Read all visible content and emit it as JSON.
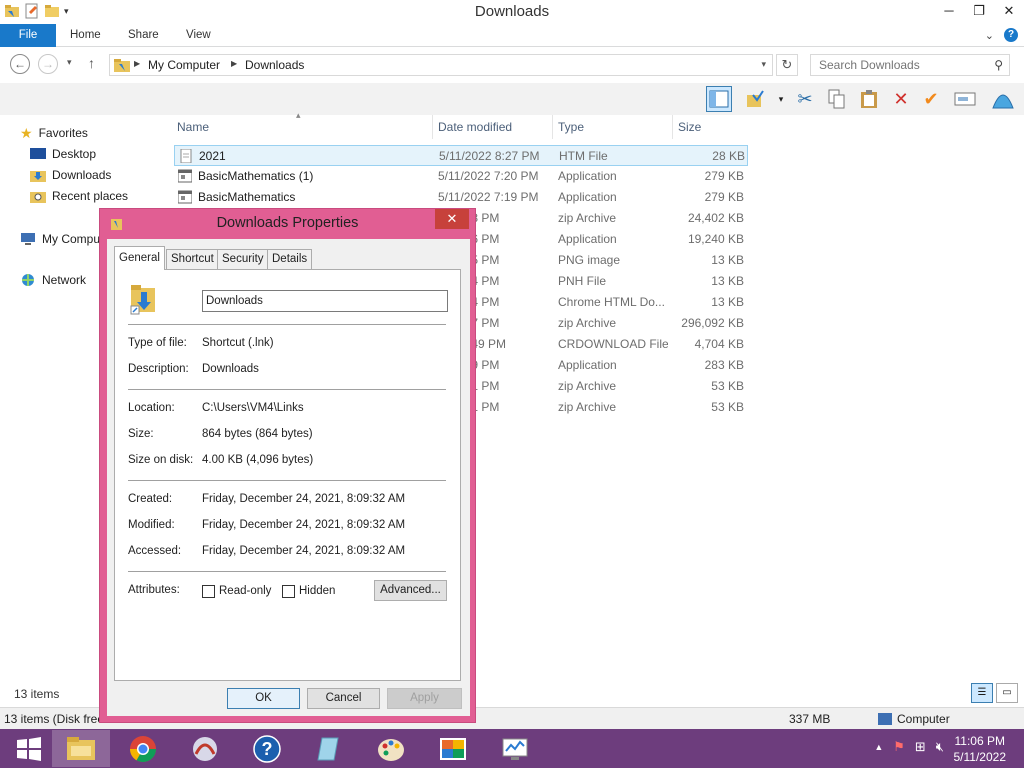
{
  "window": {
    "title": "Downloads"
  },
  "ribbon": {
    "tabs": [
      "File",
      "Home",
      "Share",
      "View"
    ]
  },
  "address": {
    "crumbs": [
      "My Computer",
      "Downloads"
    ],
    "search_placeholder": "Search Downloads"
  },
  "nav": {
    "favorites": "Favorites",
    "desktop": "Desktop",
    "downloads": "Downloads",
    "recent": "Recent places",
    "computer": "My Computer",
    "network": "Network"
  },
  "columns": {
    "name": "Name",
    "date": "Date modified",
    "type": "Type",
    "size": "Size"
  },
  "files": [
    {
      "name": "2021",
      "date": "5/11/2022 8:27 PM",
      "type": "HTM File",
      "size": "28 KB"
    },
    {
      "name": "BasicMathematics (1)",
      "date": "5/11/2022 7:20 PM",
      "type": "Application",
      "size": "279 KB"
    },
    {
      "name": "BasicMathematics",
      "date": "5/11/2022 7:19 PM",
      "type": "Application",
      "size": "279 KB"
    },
    {
      "name": "",
      "date": "22 6:38 PM",
      "type": "zip Archive",
      "size": "24,402 KB"
    },
    {
      "name": "",
      "date": "22 6:36 PM",
      "type": "Application",
      "size": "19,240 KB"
    },
    {
      "name": "",
      "date": "22 6:45 PM",
      "type": "PNG image",
      "size": "13 KB"
    },
    {
      "name": "",
      "date": "22 6:44 PM",
      "type": "PNH File",
      "size": "13 KB"
    },
    {
      "name": "",
      "date": "22 6:44 PM",
      "type": "Chrome HTML Do...",
      "size": "13 KB"
    },
    {
      "name": "",
      "date": "22 6:37 PM",
      "type": "zip Archive",
      "size": "296,092 KB"
    },
    {
      "name": "",
      "date": "22 10:49 PM",
      "type": "CRDOWNLOAD File",
      "size": "4,704 KB"
    },
    {
      "name": "",
      "date": "22 6:39 PM",
      "type": "Application",
      "size": "283 KB"
    },
    {
      "name": "",
      "date": "22 6:41 PM",
      "type": "zip Archive",
      "size": "53 KB"
    },
    {
      "name": "",
      "date": "22 6:41 PM",
      "type": "zip Archive",
      "size": "53 KB"
    }
  ],
  "status": {
    "items": "13 items",
    "items_disk": "13 items (Disk free",
    "size": "337 MB",
    "computer": "Computer"
  },
  "dialog": {
    "title": "Downloads Properties",
    "tabs": [
      "General",
      "Shortcut",
      "Security",
      "Details"
    ],
    "name_value": "Downloads",
    "type_label": "Type of file:",
    "type_value": "Shortcut (.lnk)",
    "desc_label": "Description:",
    "desc_value": "Downloads",
    "location_label": "Location:",
    "location_value": "C:\\Users\\VM4\\Links",
    "size_label": "Size:",
    "size_value": "864 bytes (864 bytes)",
    "disk_label": "Size on disk:",
    "disk_value": "4.00 KB (4,096 bytes)",
    "created_label": "Created:",
    "created_value": "Friday, December 24, 2021, 8:09:32 AM",
    "modified_label": "Modified:",
    "modified_value": "Friday, December 24, 2021, 8:09:32 AM",
    "accessed_label": "Accessed:",
    "accessed_value": "Friday, December 24, 2021, 8:09:32 AM",
    "attributes_label": "Attributes:",
    "readonly_label": "Read-only",
    "hidden_label": "Hidden",
    "advanced_label": "Advanced...",
    "ok_label": "OK",
    "cancel_label": "Cancel",
    "apply_label": "Apply"
  },
  "taskbar": {
    "time": "11:06 PM",
    "date": "5/11/2022"
  },
  "colors": {
    "accent": "#1979ca",
    "dialog_frame": "#e15e93",
    "taskbar": "#6d3d7d"
  }
}
